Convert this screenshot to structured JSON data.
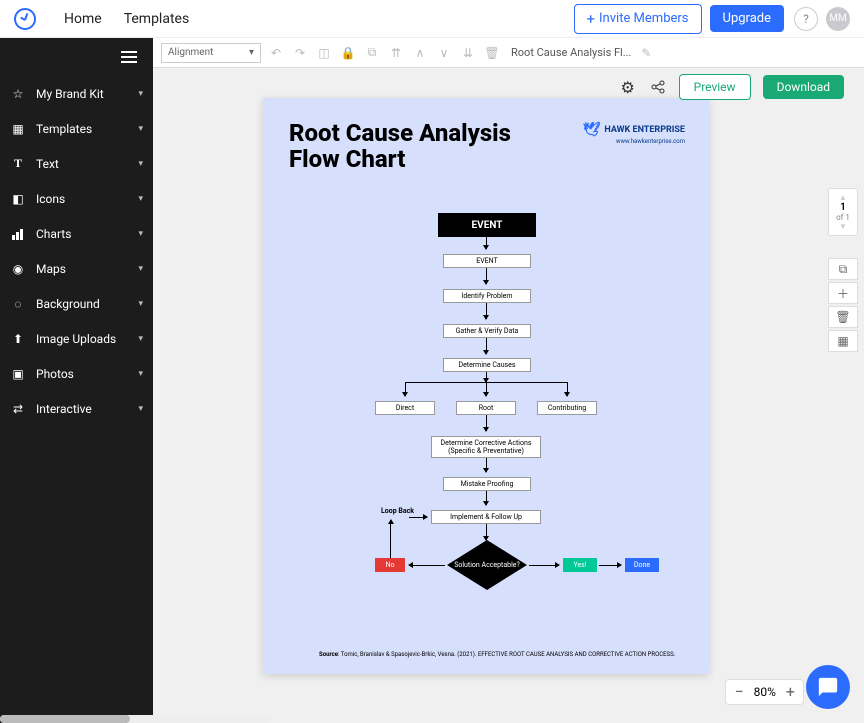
{
  "nav": {
    "home": "Home",
    "templates": "Templates",
    "invite": "Invite Members",
    "upgrade": "Upgrade",
    "help": "?",
    "avatar": "MM"
  },
  "sidebar": {
    "items": [
      {
        "label": "My Brand Kit",
        "icon": "star"
      },
      {
        "label": "Templates",
        "icon": "grid"
      },
      {
        "label": "Text",
        "icon": "T"
      },
      {
        "label": "Icons",
        "icon": "shapes"
      },
      {
        "label": "Charts",
        "icon": "bars"
      },
      {
        "label": "Maps",
        "icon": "globe"
      },
      {
        "label": "Background",
        "icon": "drop"
      },
      {
        "label": "Image Uploads",
        "icon": "upload"
      },
      {
        "label": "Photos",
        "icon": "photo"
      },
      {
        "label": "Interactive",
        "icon": "shuffle"
      }
    ]
  },
  "toolbar": {
    "alignment": "Alignment",
    "doc_title": "Root Cause Analysis Fl..."
  },
  "actions": {
    "preview": "Preview",
    "download": "Download"
  },
  "pagenav": {
    "current": "1",
    "total": "of 1"
  },
  "zoom": {
    "level": "80%"
  },
  "page": {
    "title_l1": "Root Cause Analysis",
    "title_l2": "Flow Chart",
    "brand": "HAWK ENTERPRISE",
    "brand_url": "www.hawkenterprise.com",
    "boxes": {
      "event_main": "EVENT",
      "event": "EVENT",
      "identify": "Identify Problem",
      "gather": "Gather & Verify Data",
      "determine": "Determine Causes",
      "direct": "Direct",
      "root": "Root",
      "contrib": "Contributing",
      "corrective": "Determine Corrective Actions (Specific & Preventative)",
      "mistake": "Mistake Proofing",
      "implement": "Implement & Follow Up",
      "no": "No",
      "yes": "Yes!",
      "done": "Done",
      "solution": "Solution Acceptable?",
      "loop": "Loop Back"
    },
    "source_label": "Source",
    "source_text": ": Tomic, Branislav & Spasojevic-Brkic, Vesna. (2021). EFFECTIVE ROOT CAUSE ANALYSIS AND CORRECTIVE ACTION PROCESS."
  }
}
